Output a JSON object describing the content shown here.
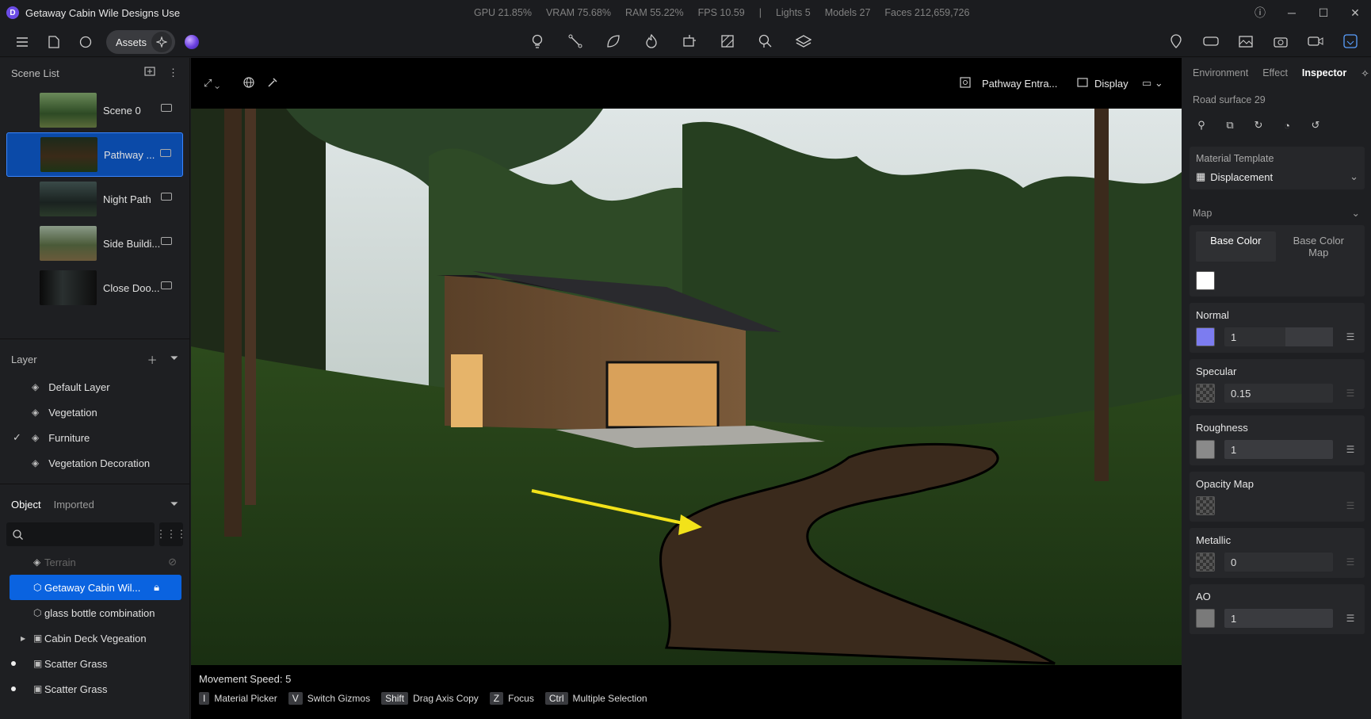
{
  "titlebar": {
    "title": "Getaway Cabin Wile Designs Use",
    "stats": [
      "GPU 21.85%",
      "VRAM 75.68%",
      "RAM 55.22%",
      "FPS 10.59",
      "|",
      "Lights 5",
      "Models 27",
      "Faces 212,659,726"
    ]
  },
  "toolbar": {
    "assets_label": "Assets"
  },
  "left": {
    "scene_list_title": "Scene List",
    "scenes": [
      {
        "name": "Scene 0"
      },
      {
        "name": "Pathway ..."
      },
      {
        "name": "Night Path"
      },
      {
        "name": "Side Buildi..."
      },
      {
        "name": "Close Doo..."
      }
    ],
    "layer_title": "Layer",
    "layers": [
      "Default Layer",
      "Vegetation",
      "Furniture",
      "Vegetation Decoration"
    ],
    "object_tab": "Object",
    "imported_tab": "Imported",
    "objects": [
      "Terrain",
      "Getaway Cabin Wil...",
      "glass bottle combination",
      "Cabin Deck Vegeation",
      "Scatter Grass",
      "Scatter Grass"
    ]
  },
  "viewport": {
    "camera_name": "Pathway Entra...",
    "display_label": "Display",
    "movement_speed": "Movement Speed: 5",
    "shortcuts": [
      {
        "key": "I",
        "label": "Material Picker"
      },
      {
        "key": "V",
        "label": "Switch Gizmos"
      },
      {
        "key": "Shift",
        "label": "Drag Axis Copy"
      },
      {
        "key": "Z",
        "label": "Focus"
      },
      {
        "key": "Ctrl",
        "label": "Multiple Selection"
      }
    ]
  },
  "right": {
    "tabs": [
      "Environment",
      "Effect",
      "Inspector"
    ],
    "object_name": "Road surface 29",
    "material_template_label": "Material Template",
    "material_template_value": "Displacement",
    "map_label": "Map",
    "base_color_tab": "Base Color",
    "base_color_map_tab": "Base Color Map",
    "normal_label": "Normal",
    "normal_value": "1",
    "specular_label": "Specular",
    "specular_value": "0.15",
    "roughness_label": "Roughness",
    "roughness_value": "1",
    "opacity_label": "Opacity Map",
    "metallic_label": "Metallic",
    "metallic_value": "0",
    "ao_label": "AO",
    "ao_value": "1"
  },
  "colors": {
    "accent": "#0a63e0",
    "normal_swatch": "#7c7cf0",
    "arrow": "#f2e21a"
  }
}
